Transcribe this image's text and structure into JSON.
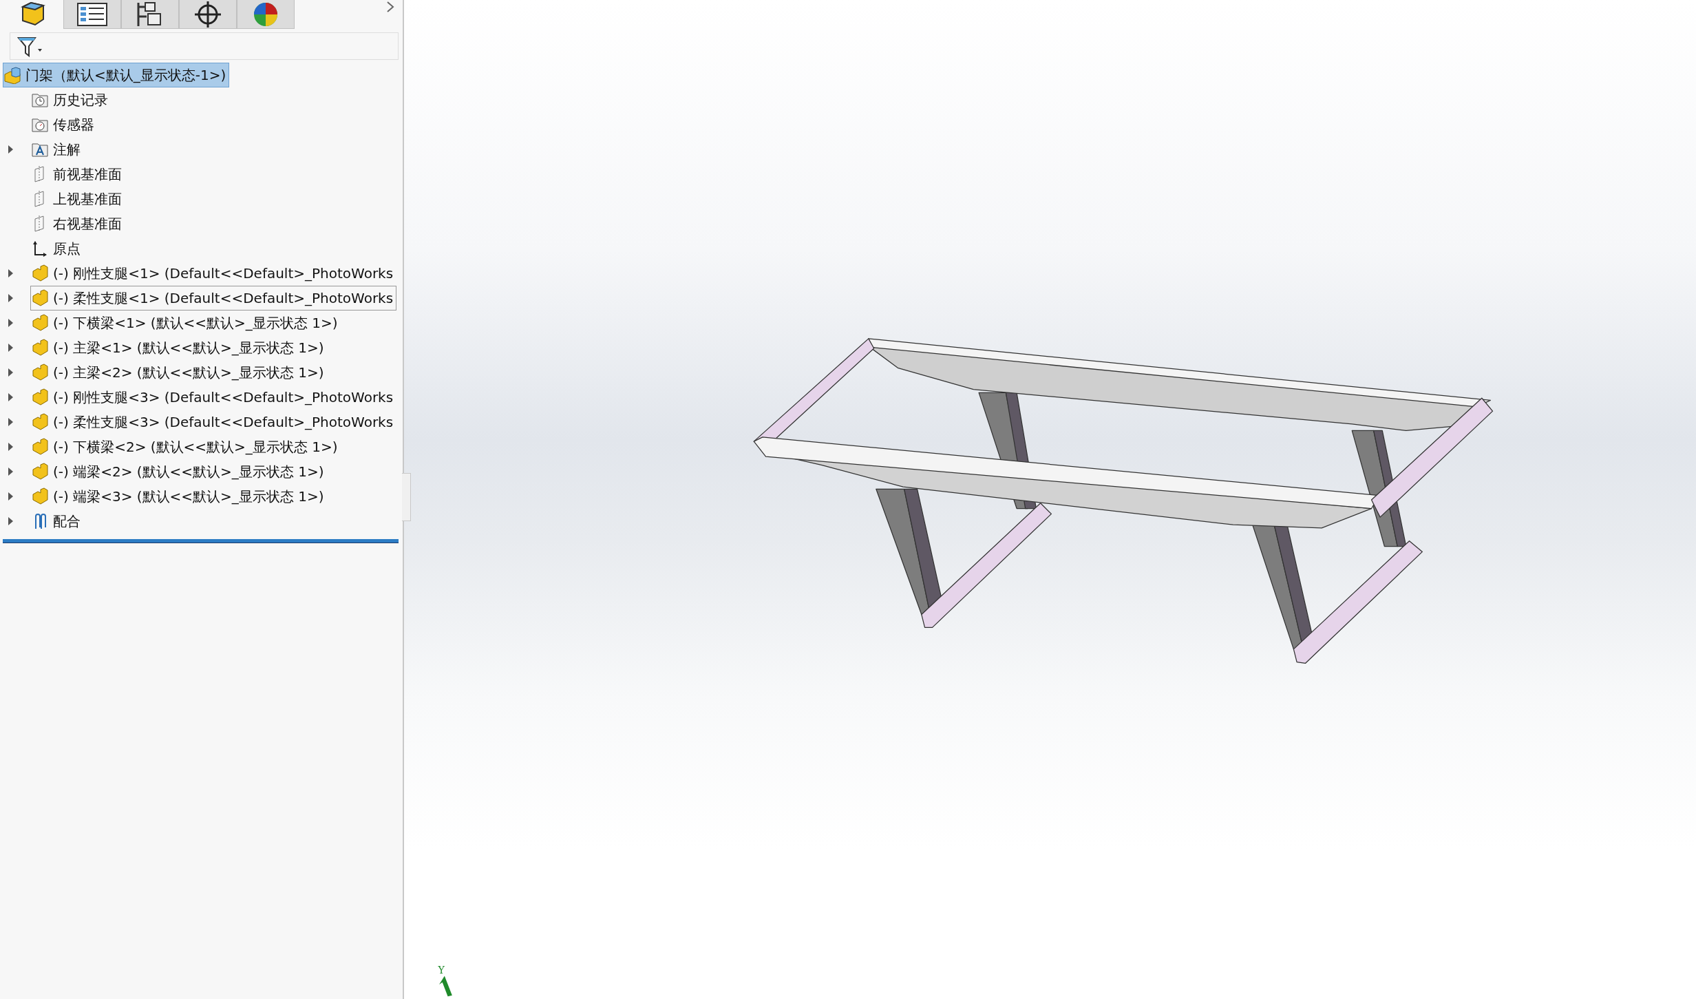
{
  "panel_tabs": [
    {
      "kind": "feature",
      "selected": true
    },
    {
      "kind": "property",
      "selected": false
    },
    {
      "kind": "config",
      "selected": false
    },
    {
      "kind": "dimxpert",
      "selected": false
    },
    {
      "kind": "display",
      "selected": false
    }
  ],
  "tree": {
    "label": "门架（默认<默认_显示状态-1>)",
    "kind": "assembly",
    "selected": true,
    "children": [
      {
        "label": "历史记录",
        "kind": "history",
        "focused": false
      },
      {
        "label": "传感器",
        "kind": "sensor",
        "focused": false
      },
      {
        "label": "注解",
        "kind": "annotation",
        "expanded": false,
        "focused": false
      },
      {
        "label": "前视基准面",
        "kind": "plane",
        "focused": false
      },
      {
        "label": "上视基准面",
        "kind": "plane",
        "focused": false
      },
      {
        "label": "右视基准面",
        "kind": "plane",
        "focused": false
      },
      {
        "label": "原点",
        "kind": "origin",
        "focused": false
      },
      {
        "label": "(-) 刚性支腿<1> (Default<<Default>_PhotoWorks",
        "kind": "part",
        "expanded": false,
        "focused": false
      },
      {
        "label": "(-) 柔性支腿<1> (Default<<Default>_PhotoWorks",
        "kind": "part",
        "expanded": false,
        "focused": true
      },
      {
        "label": "(-) 下横梁<1> (默认<<默认>_显示状态 1>)",
        "kind": "part",
        "expanded": false,
        "focused": false
      },
      {
        "label": "(-) 主梁<1> (默认<<默认>_显示状态 1>)",
        "kind": "part",
        "expanded": false,
        "focused": false
      },
      {
        "label": "(-) 主梁<2> (默认<<默认>_显示状态 1>)",
        "kind": "part",
        "expanded": false,
        "focused": false
      },
      {
        "label": "(-) 刚性支腿<3> (Default<<Default>_PhotoWorks",
        "kind": "part",
        "expanded": false,
        "focused": false
      },
      {
        "label": "(-) 柔性支腿<3> (Default<<Default>_PhotoWorks",
        "kind": "part",
        "expanded": false,
        "focused": false
      },
      {
        "label": "(-) 下横梁<2> (默认<<默认>_显示状态 1>)",
        "kind": "part",
        "expanded": false,
        "focused": false
      },
      {
        "label": "(-) 端梁<2> (默认<<默认>_显示状态 1>)",
        "kind": "part",
        "expanded": false,
        "focused": false
      },
      {
        "label": "(-) 端梁<3> (默认<<默认>_显示状态 1>)",
        "kind": "part",
        "expanded": false,
        "focused": false
      },
      {
        "label": "配合",
        "kind": "mates",
        "expanded": false,
        "focused": false
      }
    ]
  },
  "triad": {
    "axis_label": "Y"
  }
}
